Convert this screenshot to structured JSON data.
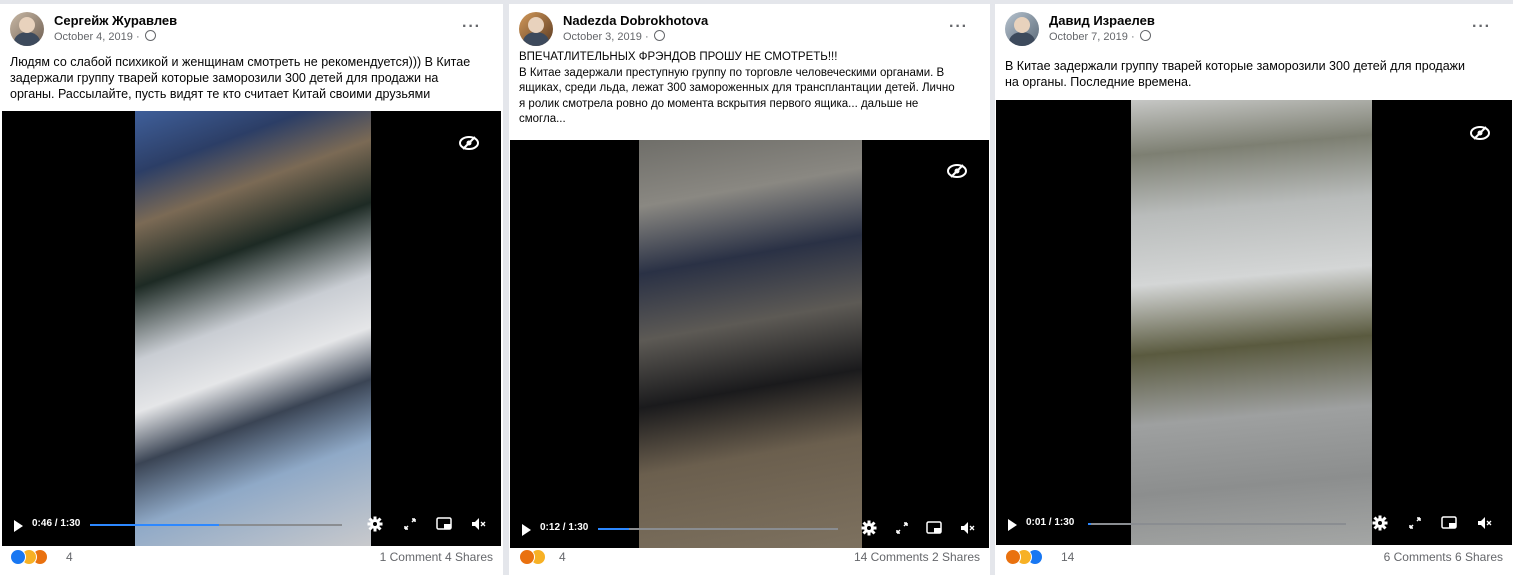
{
  "posts": [
    {
      "author": "Сергейж Журавлев",
      "date": "October 4, 2019",
      "date_sep": "·",
      "more": "···",
      "text_lines": [
        "Людям со слабой психикой и женщинам смотреть не рекомендуется))) В Китае",
        "задержали группу тварей которые заморозили 300 детей для продажи на",
        "органы. Рассылайте, пусть видят те кто считает Китай своими друзьями"
      ],
      "video": {
        "time": "0:46 / 1:30",
        "progress": 0.51
      },
      "reactions": [
        "like",
        "care",
        "angry"
      ],
      "reaction_count": "4",
      "stats": "1 Comment  4 Shares"
    },
    {
      "author": "Nadezda Dobrokhotova",
      "date": "October 3, 2019",
      "date_sep": "·",
      "more": "···",
      "text_lines": [
        "ВПЕЧАТЛИТЕЛЬНЫХ ФРЭНДОВ ПРОШУ НЕ СМОТРЕТЬ!!!",
        "В Китае задержали преступную группу по торговле человеческими органами. В",
        "ящиках, среди льда, лежат 300 замороженных для трансплантации детей. Лично",
        "я ролик смотрела ровно до момента вскрытия первого ящика... дальше не",
        "смогла..."
      ],
      "video": {
        "time": "0:12 / 1:30",
        "progress": 0.13
      },
      "reactions": [
        "angry",
        "sad"
      ],
      "reaction_count": "4",
      "stats": "14 Comments  2 Shares"
    },
    {
      "author": "Давид Израелев",
      "date": "October 7, 2019",
      "date_sep": "·",
      "more": "···",
      "text_lines": [
        "В Китае задержали группу тварей которые заморозили 300 детей для продажи",
        "на органы. Последние времена."
      ],
      "video": {
        "time": "0:01 / 1:30",
        "progress": 0.01
      },
      "reactions": [
        "angry",
        "sad",
        "like"
      ],
      "reaction_count": "14",
      "stats": "6 Comments  6 Shares"
    }
  ],
  "colors": {
    "like": "#1877f2",
    "care": "#f7b125",
    "angry": "#e9710f",
    "sad": "#f7b125",
    "progress": "#2d88ff"
  }
}
